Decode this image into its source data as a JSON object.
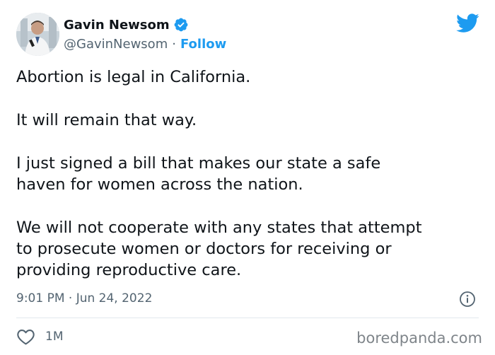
{
  "tweet": {
    "author": {
      "display_name": "Gavin Newsom",
      "handle": "@GavinNewsom",
      "separator": "·",
      "follow_label": "Follow",
      "verified": true
    },
    "paragraphs": [
      "Abortion is legal in California.",
      "It will remain that way.",
      "I just signed a bill that makes our state a safe haven for women across the nation.",
      "We will not cooperate with any states that attempt to prosecute women or doctors for receiving or providing reproductive care."
    ],
    "paragraph_lines": [
      [
        "Abortion is legal in California."
      ],
      [
        "It will remain that way."
      ],
      [
        "I just signed a bill that makes our state a safe",
        "haven for women across the nation."
      ],
      [
        "We will not cooperate with any states that attempt",
        "to prosecute women or doctors for receiving or",
        "providing reproductive care."
      ]
    ],
    "timestamp": "9:01 PM · Jun 24, 2022",
    "likes": "1M",
    "icons": {
      "platform": "twitter-bird-icon",
      "verified": "verified-badge-icon",
      "info": "info-icon",
      "like": "heart-icon"
    }
  },
  "watermark": "boredpanda.com",
  "colors": {
    "accent": "#1d9bf0",
    "text": "#0f1419",
    "secondary": "#536471",
    "divider": "#e1e8ed",
    "watermark": "#7f858a"
  }
}
